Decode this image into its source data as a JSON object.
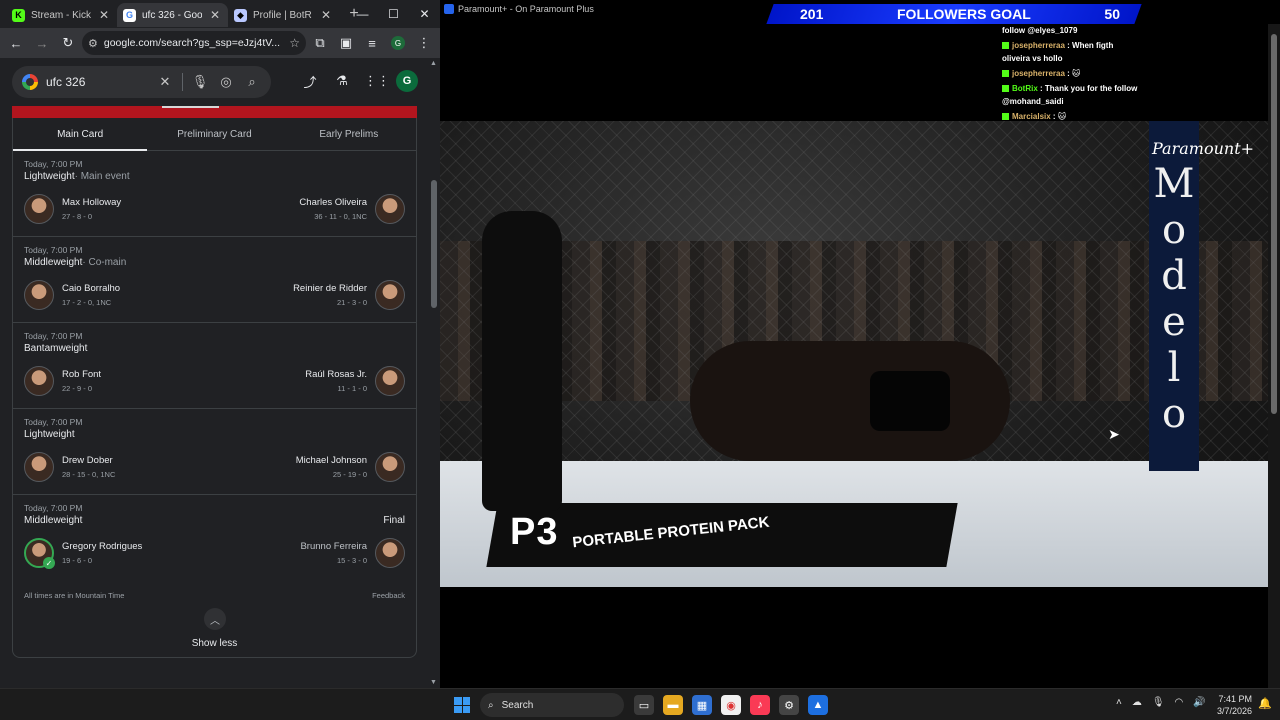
{
  "browser": {
    "tabs": [
      {
        "title": "Stream - Kick",
        "color": "#53fc18",
        "glyph": "K"
      },
      {
        "title": "ufc 326 - Goo",
        "color": "#ffffff",
        "glyph": "G"
      },
      {
        "title": "Profile | BotR",
        "color": "#b9c8ff",
        "glyph": "◆"
      }
    ],
    "url": "google.com/search?gs_ssp=eJzj4tV...",
    "profile_initial": "G"
  },
  "search": {
    "query": "ufc 326",
    "avatar_initial": "G"
  },
  "card_tabs": [
    "Main Card",
    "Preliminary Card",
    "Early Prelims"
  ],
  "fights": [
    {
      "time": "Today, 7:00 PM",
      "weight": "Lightweight",
      "note": "· Main event",
      "final": "",
      "left": {
        "name": "Max Holloway",
        "record": "27 - 8 - 0",
        "winner": false
      },
      "right": {
        "name": "Charles Oliveira",
        "record": "36 - 11 - 0, 1NC",
        "winner": false
      }
    },
    {
      "time": "Today, 7:00 PM",
      "weight": "Middleweight",
      "note": "· Co-main",
      "final": "",
      "left": {
        "name": "Caio Borralho",
        "record": "17 - 2 - 0, 1NC",
        "winner": false
      },
      "right": {
        "name": "Reinier de Ridder",
        "record": "21 - 3 - 0",
        "winner": false
      }
    },
    {
      "time": "Today, 7:00 PM",
      "weight": "Bantamweight",
      "note": "",
      "final": "",
      "left": {
        "name": "Rob Font",
        "record": "22 - 9 - 0",
        "winner": false
      },
      "right": {
        "name": "Raúl Rosas Jr.",
        "record": "11 - 1 - 0",
        "winner": false
      }
    },
    {
      "time": "Today, 7:00 PM",
      "weight": "Lightweight",
      "note": "",
      "final": "",
      "left": {
        "name": "Drew Dober",
        "record": "28 - 15 - 0, 1NC",
        "winner": false
      },
      "right": {
        "name": "Michael Johnson",
        "record": "25 - 19 - 0",
        "winner": false
      }
    },
    {
      "time": "Today, 7:00 PM",
      "weight": "Middleweight",
      "note": "",
      "final": "Final",
      "left": {
        "name": "Gregory Rodrigues",
        "record": "19 - 6 - 0",
        "winner": true
      },
      "right": {
        "name": "Brunno Ferreira",
        "record": "15 - 3 - 0",
        "winner": false
      }
    }
  ],
  "footer": {
    "times_note": "All times are in Mountain Time",
    "feedback": "Feedback",
    "show_less": "Show less"
  },
  "video": {
    "window_title": "Paramount+ - On Paramount Plus",
    "followers": {
      "current": "201",
      "label": "FOLLOWERS GOAL",
      "goal": "50"
    },
    "chat": [
      {
        "user": "",
        "text": "follow @elyes_1079"
      },
      {
        "user": "josepherreraa",
        "text": " : When figth oliveira vs hollo"
      },
      {
        "user": "josepherreraa",
        "text": " : 🐱"
      },
      {
        "user": "BotRix",
        "text": " : Thank you for the follow @mohand_saidi"
      },
      {
        "user": "Marcialsix",
        "text": " : 🐱"
      }
    ],
    "brand_overlay": "Paramount+",
    "post_text": "Modelo",
    "mat_logo": "P3",
    "mat_text": "PORTABLE PROTEIN PACK"
  },
  "taskbar": {
    "search_placeholder": "Search",
    "time": "7:41 PM",
    "date": "3/7/2026"
  }
}
